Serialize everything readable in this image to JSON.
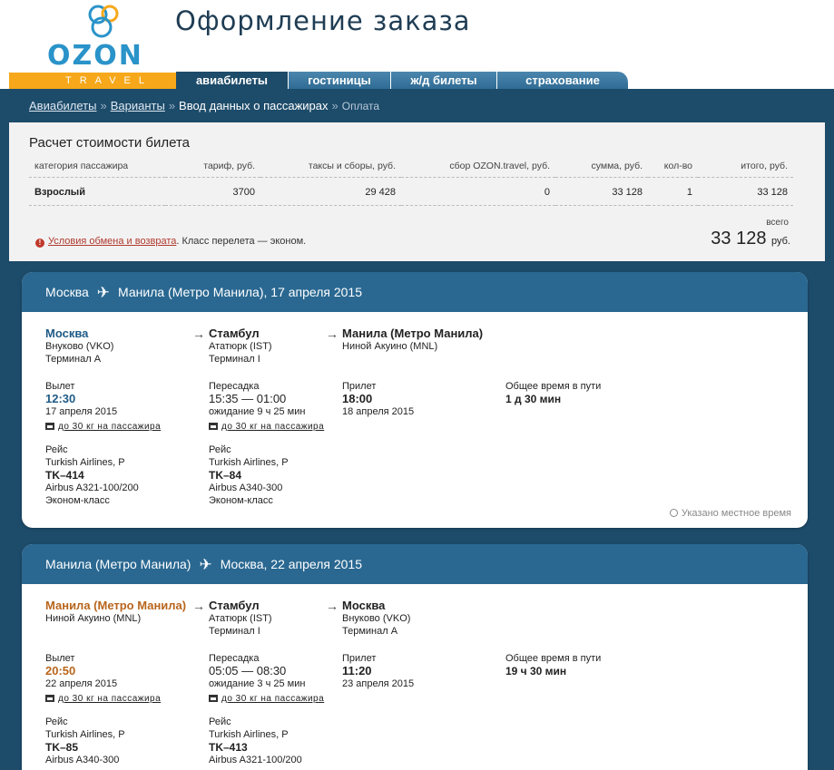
{
  "header": {
    "logo_text": "OZON",
    "logo_sub": "TRAVEL",
    "title": "Оформление заказа",
    "brand_color": "#2a93c9",
    "accent_color": "#f6a81a",
    "nav_color": "#1d4b6a"
  },
  "tabs": [
    {
      "label": "авиабилеты",
      "active": true
    },
    {
      "label": "гостиницы",
      "active": false
    },
    {
      "label": "ж/д билеты",
      "active": false
    },
    {
      "label": "страхование",
      "active": false
    }
  ],
  "breadcrumb": {
    "step1": "Авиабилеты",
    "step2": "Варианты",
    "step3": "Ввод данных о пассажирах",
    "step4": "Оплата",
    "separator": "»"
  },
  "price": {
    "title": "Расчет стоимости билета",
    "headers": [
      "категория пассажира",
      "тариф, руб.",
      "таксы и сборы, руб.",
      "сбор OZON.travel, руб.",
      "сумма, руб.",
      "кол-во",
      "итого, руб."
    ],
    "row": [
      "Взрослый",
      "3700",
      "29 428",
      "0",
      "33 128",
      "1",
      "33 128"
    ],
    "note_link": "Условия обмена и возврата",
    "note_text": ". Класс перелета — эконом.",
    "total_label": "всего",
    "total_value": "33 128",
    "total_unit": "руб."
  },
  "flights": [
    {
      "route_from": "Москва",
      "route_to": "Манила (Метро Манила), 17 апреля 2015",
      "from_city": "Москва",
      "from_airport": "Внуково (VKO)",
      "from_terminal": "Терминал А",
      "via_city": "Стамбул",
      "via_airport": "Ататюрк (IST)",
      "via_terminal": "Терминал I",
      "to_city": "Манила (Метро Манила)",
      "to_airport": "Ниной Акуино (MNL)",
      "dep_label": "Вылет",
      "dep_time": "12:30",
      "dep_date": "17 апреля 2015",
      "bag": "до 30 кг на пассажира",
      "transfer_label": "Пересадка",
      "transfer_time": "15:35 — 01:00",
      "transfer_wait": "ожидание 9 ч 25 мин",
      "bag2": "до 30 кг на пассажира",
      "arr_label": "Прилет",
      "arr_time": "18:00",
      "arr_date": "18 апреля 2015",
      "total_label": "Общее время в пути",
      "total_time": "1 д 30 мин",
      "flight1_label": "Рейс",
      "flight1_airline": "Turkish Airlines, P",
      "flight1_num": "TK–414",
      "flight1_plane": "Airbus A321-100/200",
      "flight1_class": "Эконом-класс",
      "flight2_label": "Рейс",
      "flight2_airline": "Turkish Airlines, P",
      "flight2_num": "TK–84",
      "flight2_plane": "Airbus A340-300",
      "flight2_class": "Эконом-класс",
      "local_note": "Указано местное время"
    },
    {
      "route_from": "Манила (Метро Манила)",
      "route_to": "Москва, 22 апреля 2015",
      "from_city": "Манила (Метро Манила)",
      "from_airport": "Ниной Акуино (MNL)",
      "via_city": "Стамбул",
      "via_airport": "Ататюрк (IST)",
      "via_terminal": "Терминал I",
      "to_city": "Москва",
      "to_airport": "Внуково (VKO)",
      "to_terminal": "Терминал А",
      "dep_label": "Вылет",
      "dep_time": "20:50",
      "dep_date": "22 апреля 2015",
      "bag": "до 30 кг на пассажира",
      "transfer_label": "Пересадка",
      "transfer_time": "05:05 — 08:30",
      "transfer_wait": "ожидание 3 ч 25 мин",
      "bag2": "до 30 кг на пассажира",
      "arr_label": "Прилет",
      "arr_time": "11:20",
      "arr_date": "23 апреля 2015",
      "total_label": "Общее время в пути",
      "total_time": "19 ч 30 мин",
      "flight1_label": "Рейс",
      "flight1_airline": "Turkish Airlines, P",
      "flight1_num": "TK–85",
      "flight1_plane": "Airbus A340-300",
      "flight2_label": "Рейс",
      "flight2_airline": "Turkish Airlines, P",
      "flight2_num": "TK–413",
      "flight2_plane": "Airbus A321-100/200"
    }
  ]
}
